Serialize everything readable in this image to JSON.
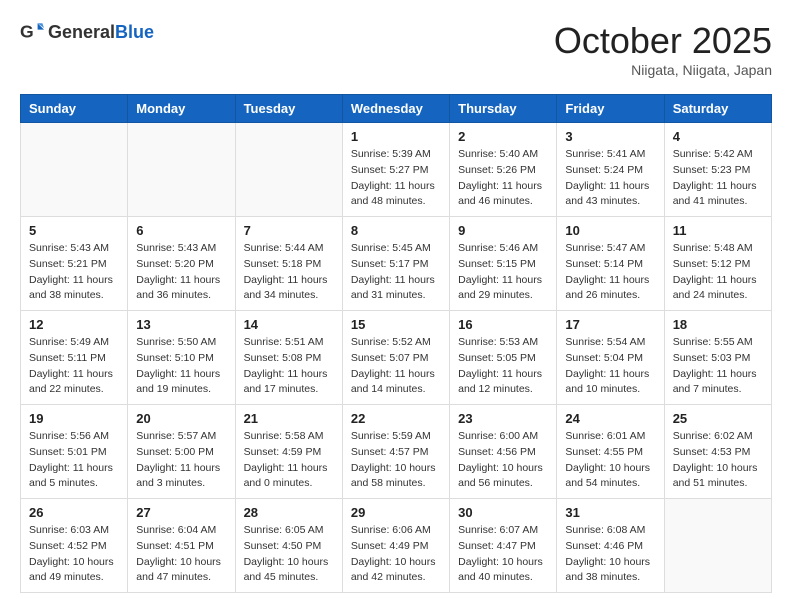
{
  "header": {
    "logo_general": "General",
    "logo_blue": "Blue",
    "month": "October 2025",
    "location": "Niigata, Niigata, Japan"
  },
  "weekdays": [
    "Sunday",
    "Monday",
    "Tuesday",
    "Wednesday",
    "Thursday",
    "Friday",
    "Saturday"
  ],
  "weeks": [
    [
      {
        "day": "",
        "info": ""
      },
      {
        "day": "",
        "info": ""
      },
      {
        "day": "",
        "info": ""
      },
      {
        "day": "1",
        "info": "Sunrise: 5:39 AM\nSunset: 5:27 PM\nDaylight: 11 hours\nand 48 minutes."
      },
      {
        "day": "2",
        "info": "Sunrise: 5:40 AM\nSunset: 5:26 PM\nDaylight: 11 hours\nand 46 minutes."
      },
      {
        "day": "3",
        "info": "Sunrise: 5:41 AM\nSunset: 5:24 PM\nDaylight: 11 hours\nand 43 minutes."
      },
      {
        "day": "4",
        "info": "Sunrise: 5:42 AM\nSunset: 5:23 PM\nDaylight: 11 hours\nand 41 minutes."
      }
    ],
    [
      {
        "day": "5",
        "info": "Sunrise: 5:43 AM\nSunset: 5:21 PM\nDaylight: 11 hours\nand 38 minutes."
      },
      {
        "day": "6",
        "info": "Sunrise: 5:43 AM\nSunset: 5:20 PM\nDaylight: 11 hours\nand 36 minutes."
      },
      {
        "day": "7",
        "info": "Sunrise: 5:44 AM\nSunset: 5:18 PM\nDaylight: 11 hours\nand 34 minutes."
      },
      {
        "day": "8",
        "info": "Sunrise: 5:45 AM\nSunset: 5:17 PM\nDaylight: 11 hours\nand 31 minutes."
      },
      {
        "day": "9",
        "info": "Sunrise: 5:46 AM\nSunset: 5:15 PM\nDaylight: 11 hours\nand 29 minutes."
      },
      {
        "day": "10",
        "info": "Sunrise: 5:47 AM\nSunset: 5:14 PM\nDaylight: 11 hours\nand 26 minutes."
      },
      {
        "day": "11",
        "info": "Sunrise: 5:48 AM\nSunset: 5:12 PM\nDaylight: 11 hours\nand 24 minutes."
      }
    ],
    [
      {
        "day": "12",
        "info": "Sunrise: 5:49 AM\nSunset: 5:11 PM\nDaylight: 11 hours\nand 22 minutes."
      },
      {
        "day": "13",
        "info": "Sunrise: 5:50 AM\nSunset: 5:10 PM\nDaylight: 11 hours\nand 19 minutes."
      },
      {
        "day": "14",
        "info": "Sunrise: 5:51 AM\nSunset: 5:08 PM\nDaylight: 11 hours\nand 17 minutes."
      },
      {
        "day": "15",
        "info": "Sunrise: 5:52 AM\nSunset: 5:07 PM\nDaylight: 11 hours\nand 14 minutes."
      },
      {
        "day": "16",
        "info": "Sunrise: 5:53 AM\nSunset: 5:05 PM\nDaylight: 11 hours\nand 12 minutes."
      },
      {
        "day": "17",
        "info": "Sunrise: 5:54 AM\nSunset: 5:04 PM\nDaylight: 11 hours\nand 10 minutes."
      },
      {
        "day": "18",
        "info": "Sunrise: 5:55 AM\nSunset: 5:03 PM\nDaylight: 11 hours\nand 7 minutes."
      }
    ],
    [
      {
        "day": "19",
        "info": "Sunrise: 5:56 AM\nSunset: 5:01 PM\nDaylight: 11 hours\nand 5 minutes."
      },
      {
        "day": "20",
        "info": "Sunrise: 5:57 AM\nSunset: 5:00 PM\nDaylight: 11 hours\nand 3 minutes."
      },
      {
        "day": "21",
        "info": "Sunrise: 5:58 AM\nSunset: 4:59 PM\nDaylight: 11 hours\nand 0 minutes."
      },
      {
        "day": "22",
        "info": "Sunrise: 5:59 AM\nSunset: 4:57 PM\nDaylight: 10 hours\nand 58 minutes."
      },
      {
        "day": "23",
        "info": "Sunrise: 6:00 AM\nSunset: 4:56 PM\nDaylight: 10 hours\nand 56 minutes."
      },
      {
        "day": "24",
        "info": "Sunrise: 6:01 AM\nSunset: 4:55 PM\nDaylight: 10 hours\nand 54 minutes."
      },
      {
        "day": "25",
        "info": "Sunrise: 6:02 AM\nSunset: 4:53 PM\nDaylight: 10 hours\nand 51 minutes."
      }
    ],
    [
      {
        "day": "26",
        "info": "Sunrise: 6:03 AM\nSunset: 4:52 PM\nDaylight: 10 hours\nand 49 minutes."
      },
      {
        "day": "27",
        "info": "Sunrise: 6:04 AM\nSunset: 4:51 PM\nDaylight: 10 hours\nand 47 minutes."
      },
      {
        "day": "28",
        "info": "Sunrise: 6:05 AM\nSunset: 4:50 PM\nDaylight: 10 hours\nand 45 minutes."
      },
      {
        "day": "29",
        "info": "Sunrise: 6:06 AM\nSunset: 4:49 PM\nDaylight: 10 hours\nand 42 minutes."
      },
      {
        "day": "30",
        "info": "Sunrise: 6:07 AM\nSunset: 4:47 PM\nDaylight: 10 hours\nand 40 minutes."
      },
      {
        "day": "31",
        "info": "Sunrise: 6:08 AM\nSunset: 4:46 PM\nDaylight: 10 hours\nand 38 minutes."
      },
      {
        "day": "",
        "info": ""
      }
    ]
  ]
}
